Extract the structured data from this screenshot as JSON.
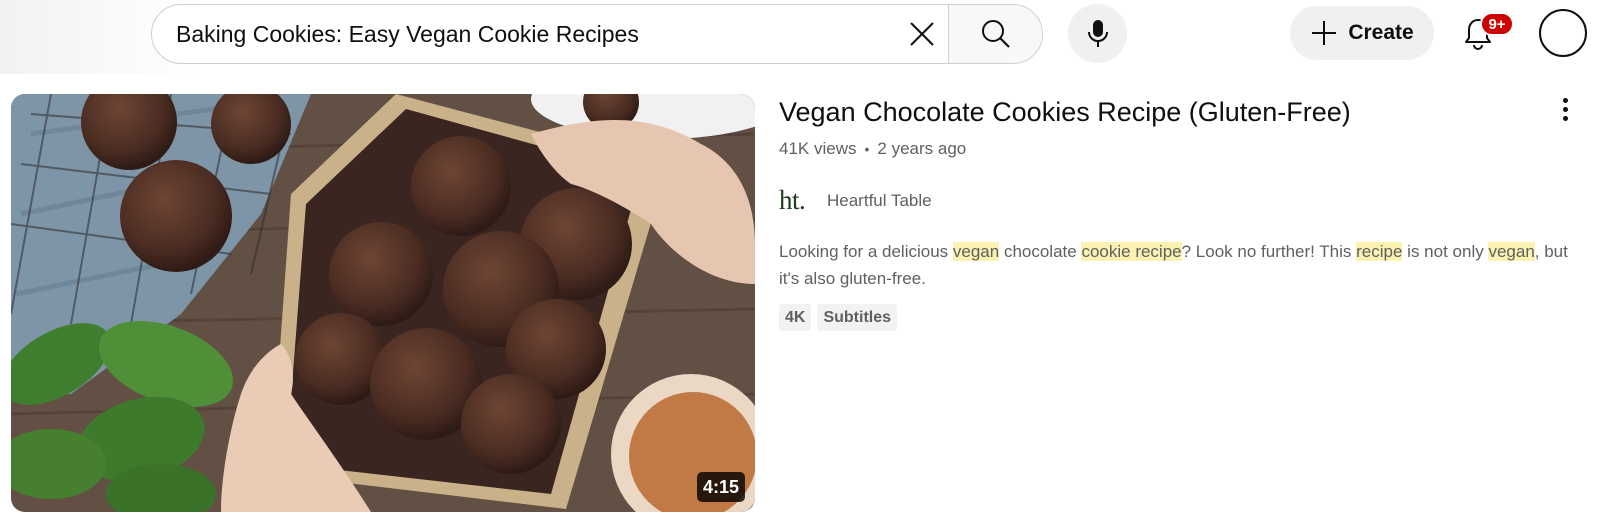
{
  "header": {
    "search": {
      "value": "Baking Cookies: Easy Vegan Cookie Recipes",
      "clear_icon": "close-icon",
      "search_icon": "search-icon"
    },
    "mic_icon": "microphone-icon",
    "create": {
      "label": "Create",
      "icon": "plus-icon"
    },
    "notifications": {
      "icon": "bell-icon",
      "badge": "9+",
      "badge_color": "#cc0000"
    },
    "avatar_icon": "avatar"
  },
  "result": {
    "thumbnail": {
      "duration": "4:15"
    },
    "title": "Vegan Chocolate Cookies Recipe (Gluten-Free)",
    "views": "41K views",
    "separator": "•",
    "age": "2 years ago",
    "channel": {
      "logo_text": "ht.",
      "name": "Heartful Table"
    },
    "description": {
      "parts": [
        {
          "text": "Looking for a delicious ",
          "highlight": false
        },
        {
          "text": "vegan",
          "highlight": true
        },
        {
          "text": " chocolate ",
          "highlight": false
        },
        {
          "text": "cookie recipe",
          "highlight": true
        },
        {
          "text": "? Look no further! This ",
          "highlight": false
        },
        {
          "text": "recipe",
          "highlight": true
        },
        {
          "text": " is not only ",
          "highlight": false
        },
        {
          "text": "vegan",
          "highlight": true
        },
        {
          "text": ", but it's also gluten-free.",
          "highlight": false
        }
      ]
    },
    "badges": [
      "4K",
      "Subtitles"
    ],
    "more_icon": "more-vertical-icon"
  }
}
